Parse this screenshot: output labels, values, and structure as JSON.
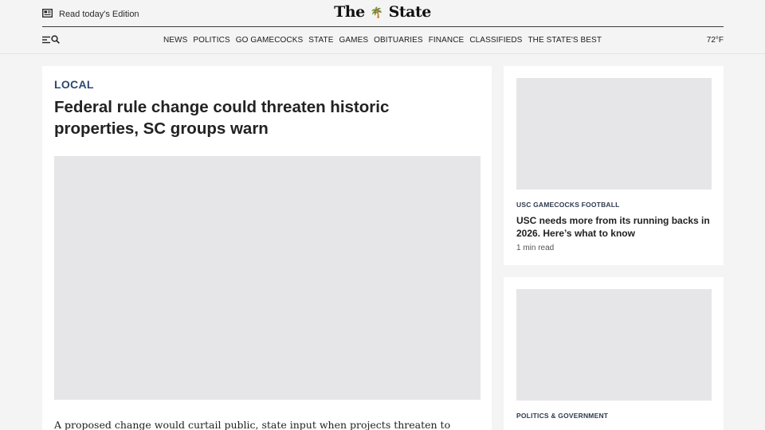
{
  "header": {
    "edition_label": "Read today's Edition",
    "logo_left": "The",
    "logo_right": "State",
    "temperature": "72°F"
  },
  "nav": {
    "items": [
      "NEWS",
      "POLITICS",
      "GO GAMECOCKS",
      "STATE",
      "GAMES",
      "OBITUARIES",
      "FINANCE",
      "CLASSIFIEDS",
      "THE STATE'S BEST"
    ]
  },
  "article": {
    "section": "LOCAL",
    "headline": "Federal rule change could threaten historic properties, SC groups warn",
    "summary": "A proposed change would curtail public, state input when projects threaten to disrupt or"
  },
  "sidebar": {
    "stories": [
      {
        "category": "USC GAMECOCKS FOOTBALL",
        "title": "USC needs more from its running backs in 2026. Here’s what to know",
        "meta": "1 min read"
      },
      {
        "category": "POLITICS & GOVERNMENT"
      }
    ]
  },
  "icons": {
    "edition": "newspaper-icon",
    "menu": "hamburger-icon",
    "search": "search-icon"
  },
  "colors": {
    "section_label": "#2f4870",
    "page_background": "#f4f4f5",
    "image_placeholder": "#e6e6e8"
  }
}
